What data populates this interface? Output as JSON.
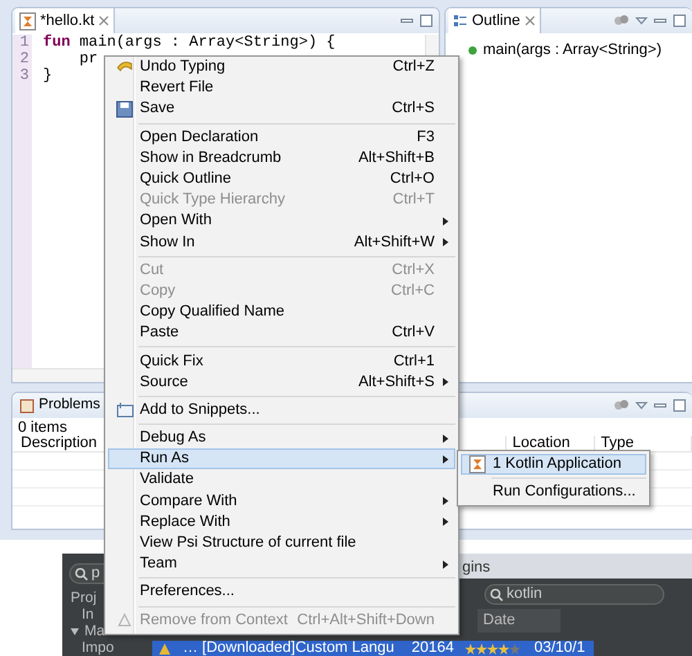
{
  "editor": {
    "tab": {
      "title": "*hello.kt",
      "selected": true
    },
    "lines": [
      {
        "number": "1",
        "code": "**fun** main(args : Array<String>) {"
      },
      {
        "number": "2",
        "code": "    pr"
      },
      {
        "number": "3",
        "code": "}"
      }
    ]
  },
  "outline": {
    "title": "Outline",
    "items": [
      {
        "label": "main(args : Array<String>)"
      }
    ]
  },
  "problems": {
    "title": "Problems",
    "summary": "0 items",
    "columns": [
      "Description",
      "Location",
      "Type"
    ]
  },
  "context_menu": {
    "items": [
      {
        "kind": "item",
        "label": "Undo Typing",
        "shortcut": "Ctrl+Z",
        "disabled": false,
        "submenu": false,
        "selected": false
      },
      {
        "kind": "item",
        "label": "Revert File",
        "disabled": false,
        "submenu": false,
        "selected": false
      },
      {
        "kind": "item",
        "label": "Save",
        "shortcut": "Ctrl+S",
        "disabled": false,
        "submenu": false,
        "selected": false
      },
      {
        "kind": "separator"
      },
      {
        "kind": "item",
        "label": "Open Declaration",
        "shortcut": "F3",
        "disabled": false,
        "submenu": false,
        "selected": false
      },
      {
        "kind": "item",
        "label": "Show in Breadcrumb",
        "shortcut": "Alt+Shift+B",
        "disabled": false,
        "submenu": false,
        "selected": false
      },
      {
        "kind": "item",
        "label": "Quick Outline",
        "shortcut": "Ctrl+O",
        "disabled": false,
        "submenu": false,
        "selected": false
      },
      {
        "kind": "item",
        "label": "Quick Type Hierarchy",
        "shortcut": "Ctrl+T",
        "disabled": true,
        "submenu": false,
        "selected": false
      },
      {
        "kind": "item",
        "label": "Open With",
        "disabled": false,
        "submenu": true,
        "selected": false
      },
      {
        "kind": "item",
        "label": "Show In",
        "shortcut": "Alt+Shift+W",
        "disabled": false,
        "submenu": true,
        "selected": false
      },
      {
        "kind": "separator"
      },
      {
        "kind": "item",
        "label": "Cut",
        "shortcut": "Ctrl+X",
        "disabled": true,
        "submenu": false,
        "selected": false
      },
      {
        "kind": "item",
        "label": "Copy",
        "shortcut": "Ctrl+C",
        "disabled": true,
        "submenu": false,
        "selected": false
      },
      {
        "kind": "item",
        "label": "Copy Qualified Name",
        "disabled": false,
        "submenu": false,
        "selected": false
      },
      {
        "kind": "item",
        "label": "Paste",
        "shortcut": "Ctrl+V",
        "disabled": false,
        "submenu": false,
        "selected": false
      },
      {
        "kind": "separator"
      },
      {
        "kind": "item",
        "label": "Quick Fix",
        "shortcut": "Ctrl+1",
        "disabled": false,
        "submenu": false,
        "selected": false
      },
      {
        "kind": "item",
        "label": "Source",
        "shortcut": "Alt+Shift+S",
        "disabled": false,
        "submenu": true,
        "selected": false
      },
      {
        "kind": "separator"
      },
      {
        "kind": "item",
        "label": "Add to Snippets...",
        "disabled": false,
        "submenu": false,
        "selected": false
      },
      {
        "kind": "separator"
      },
      {
        "kind": "item",
        "label": "Debug As",
        "disabled": false,
        "submenu": true,
        "selected": false
      },
      {
        "kind": "item",
        "label": "Run As",
        "disabled": false,
        "submenu": true,
        "selected": true
      },
      {
        "kind": "item",
        "label": "Validate",
        "disabled": false,
        "submenu": false,
        "selected": false
      },
      {
        "kind": "item",
        "label": "Compare With",
        "disabled": false,
        "submenu": true,
        "selected": false
      },
      {
        "kind": "item",
        "label": "Replace With",
        "disabled": false,
        "submenu": true,
        "selected": false
      },
      {
        "kind": "item",
        "label": "View Psi Structure of current file",
        "disabled": false,
        "submenu": false,
        "selected": false
      },
      {
        "kind": "item",
        "label": "Team",
        "disabled": false,
        "submenu": true,
        "selected": false
      },
      {
        "kind": "separator"
      },
      {
        "kind": "item",
        "label": "Preferences...",
        "disabled": false,
        "submenu": false,
        "selected": false
      },
      {
        "kind": "separator"
      },
      {
        "kind": "item",
        "label": "Remove from Context",
        "shortcut": "Ctrl+Alt+Shift+Down",
        "disabled": true,
        "submenu": false,
        "selected": false
      }
    ]
  },
  "run_as_submenu": {
    "items": [
      {
        "kind": "item",
        "label": "1 Kotlin Application",
        "selected": true
      },
      {
        "kind": "separator"
      },
      {
        "kind": "item",
        "label": "Run Configurations...",
        "selected": false
      }
    ]
  },
  "plugins_dialog": {
    "title": "gins",
    "filter": "p",
    "search": "kotlin",
    "tree": [
      {
        "label": "Proj",
        "children": [
          {
            "label": "In"
          }
        ]
      },
      {
        "label": "Ma",
        "expanded": true,
        "children": [
          {
            "label": "Impo"
          }
        ]
      }
    ],
    "columns": [
      "Date"
    ],
    "rows": [
      {
        "name": "… [Downloaded]Custom Langu",
        "downloads": "20164",
        "stars": 4,
        "date": "03/10/1",
        "selected": true
      }
    ]
  }
}
